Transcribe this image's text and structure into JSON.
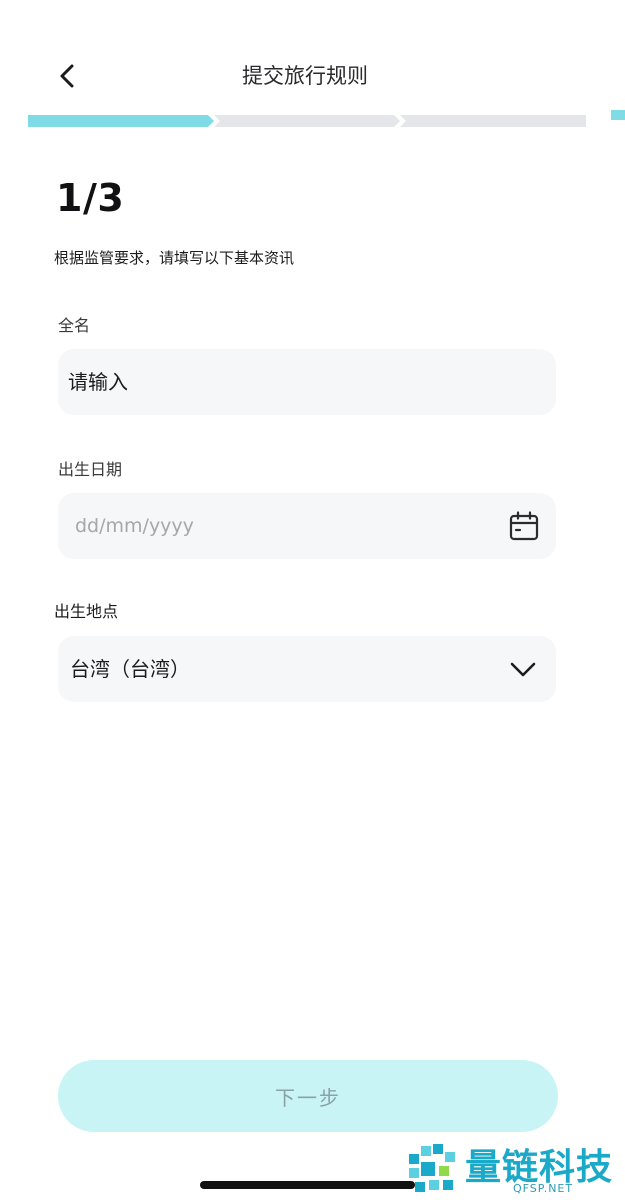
{
  "header": {
    "title": "提交旅行规则",
    "back_icon": "chevron-left-icon"
  },
  "stepper": {
    "current_step": 1,
    "total_steps": 3,
    "active_color": "#7fdbe6",
    "inactive_color": "#e4e6e9"
  },
  "form": {
    "step_counter": "1/3",
    "intro": "根据监管要求，请填写以下基本资讯",
    "full_name": {
      "label": "全名",
      "placeholder": "请输入",
      "value": ""
    },
    "birth_date": {
      "label": "出生日期",
      "placeholder": "dd/mm/yyyy",
      "value": "",
      "icon": "calendar-icon"
    },
    "birth_place": {
      "label": "出生地点",
      "selected": "台湾（台湾）",
      "icon": "chevron-down-icon"
    }
  },
  "footer": {
    "next_label": "下一步",
    "button_color": "#c8f4f6"
  },
  "watermark": {
    "text": "量链科技",
    "sub": "QFSP.NET",
    "color": "#1aa9c8"
  }
}
